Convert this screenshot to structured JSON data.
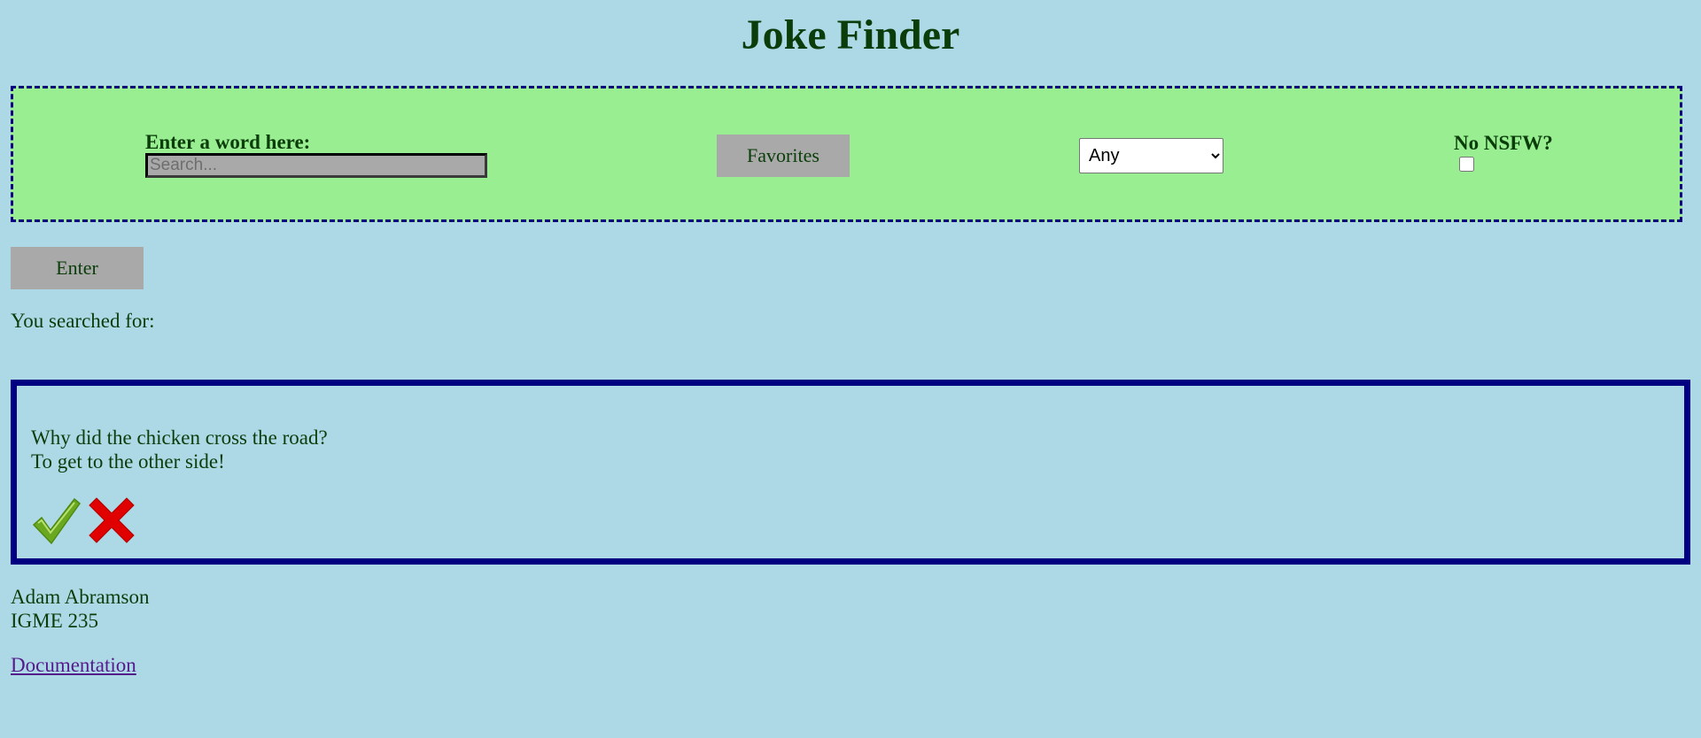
{
  "page_title": "Joke Finder",
  "controls": {
    "search_label": "Enter a word here:",
    "search_placeholder": "Search...",
    "search_value": "",
    "favorites_label": "Favorites",
    "category_selected": "Any",
    "nsfw_label": "No NSFW?",
    "nsfw_checked": false
  },
  "enter_label": "Enter",
  "searched_for_label": "You searched for:",
  "joke": {
    "setup": "Why did the chicken cross the road?",
    "punchline": "To get to the other side!",
    "like_icon": "checkmark-icon",
    "dislike_icon": "x-mark-icon"
  },
  "footer": {
    "author": "Adam Abramson",
    "course": "IGME 235",
    "doc_link": "Documentation"
  },
  "colors": {
    "background": "#add8e6",
    "controls_bg": "#98ee90",
    "border": "#000080",
    "text": "#0b3d0b",
    "button_bg": "#a9a9a9",
    "check_green": "#6aa820",
    "x_red": "#e00000"
  }
}
